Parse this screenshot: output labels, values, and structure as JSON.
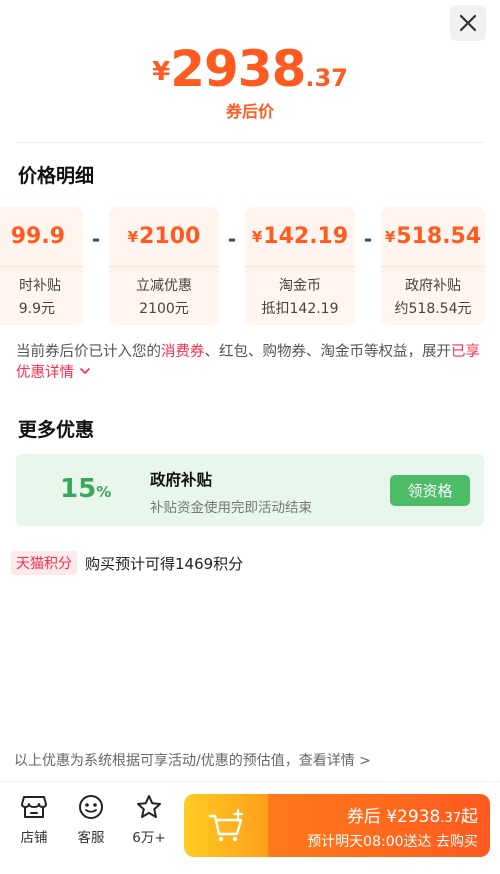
{
  "header": {
    "close_icon": "close-icon",
    "price_symbol": "¥",
    "price_integer": "2938",
    "price_decimal": ".37",
    "price_caption": "券后价"
  },
  "breakdown": {
    "title": "价格明细",
    "items": [
      {
        "amount": "99.9",
        "label": "时补贴",
        "sub": "9.9元"
      },
      {
        "symbol": "¥",
        "amount": "2100",
        "label": "立减优惠",
        "sub": "2100元"
      },
      {
        "symbol": "¥",
        "amount": "142.19",
        "label": "淘金币",
        "sub": "抵扣142.19"
      },
      {
        "symbol": "¥",
        "amount": "518.54",
        "label": "政府补贴",
        "sub": "约518.54元"
      }
    ],
    "operator": "-"
  },
  "note": {
    "part1": "当前券后价已计入您的",
    "highlight": "消费券",
    "part2": "、红包、购物券、淘金币等权益，展开",
    "link": "已享优惠详情"
  },
  "more": {
    "title": "更多优惠",
    "gov": {
      "percent": "15",
      "percent_unit": "%",
      "title": "政府补贴",
      "desc": "补贴资金使用完即活动结束",
      "button": "领资格"
    },
    "points_tag": "天猫积分",
    "points_text": "购买预计可得1469积分"
  },
  "disclaimer": "以上优惠为系统根据可享活动/优惠的预估值，查看详情 >",
  "bottom": {
    "nav": [
      {
        "label": "店铺",
        "icon": "store-icon"
      },
      {
        "label": "客服",
        "icon": "customer-service-icon"
      },
      {
        "label": "6万+",
        "icon": "star-icon"
      }
    ],
    "buy": {
      "line1_prefix": "券后",
      "line1_symbol": "¥",
      "line1_int": "2938",
      "line1_dec": ".37",
      "line1_suffix": "起",
      "line2_left": "预计明天08:00送达",
      "line2_right": "去购买"
    }
  },
  "colors": {
    "accent": "#ff5a1f",
    "red": "#ff2b4f",
    "green": "#4cbc69"
  }
}
